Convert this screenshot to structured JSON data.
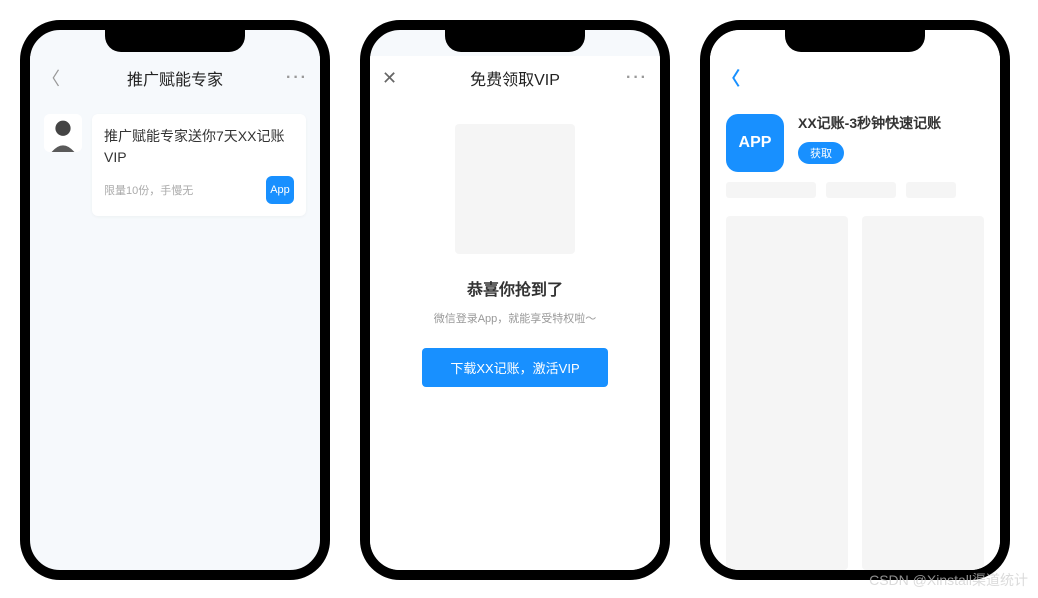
{
  "phone1": {
    "nav_title": "推广赋能专家",
    "card_title": "推广赋能专家送你7天XX记账VIP",
    "card_sub": "限量10份，手慢无",
    "app_badge": "App"
  },
  "phone2": {
    "nav_title": "免费领取VIP",
    "title": "恭喜你抢到了",
    "sub": "微信登录App，就能享受特权啦～",
    "button": "下载XX记账，激活VIP"
  },
  "phone3": {
    "app_icon_label": "APP",
    "app_name": "XX记账-3秒钟快速记账",
    "get_button": "获取"
  },
  "watermark": "CSDN @Xinstall渠道统计"
}
